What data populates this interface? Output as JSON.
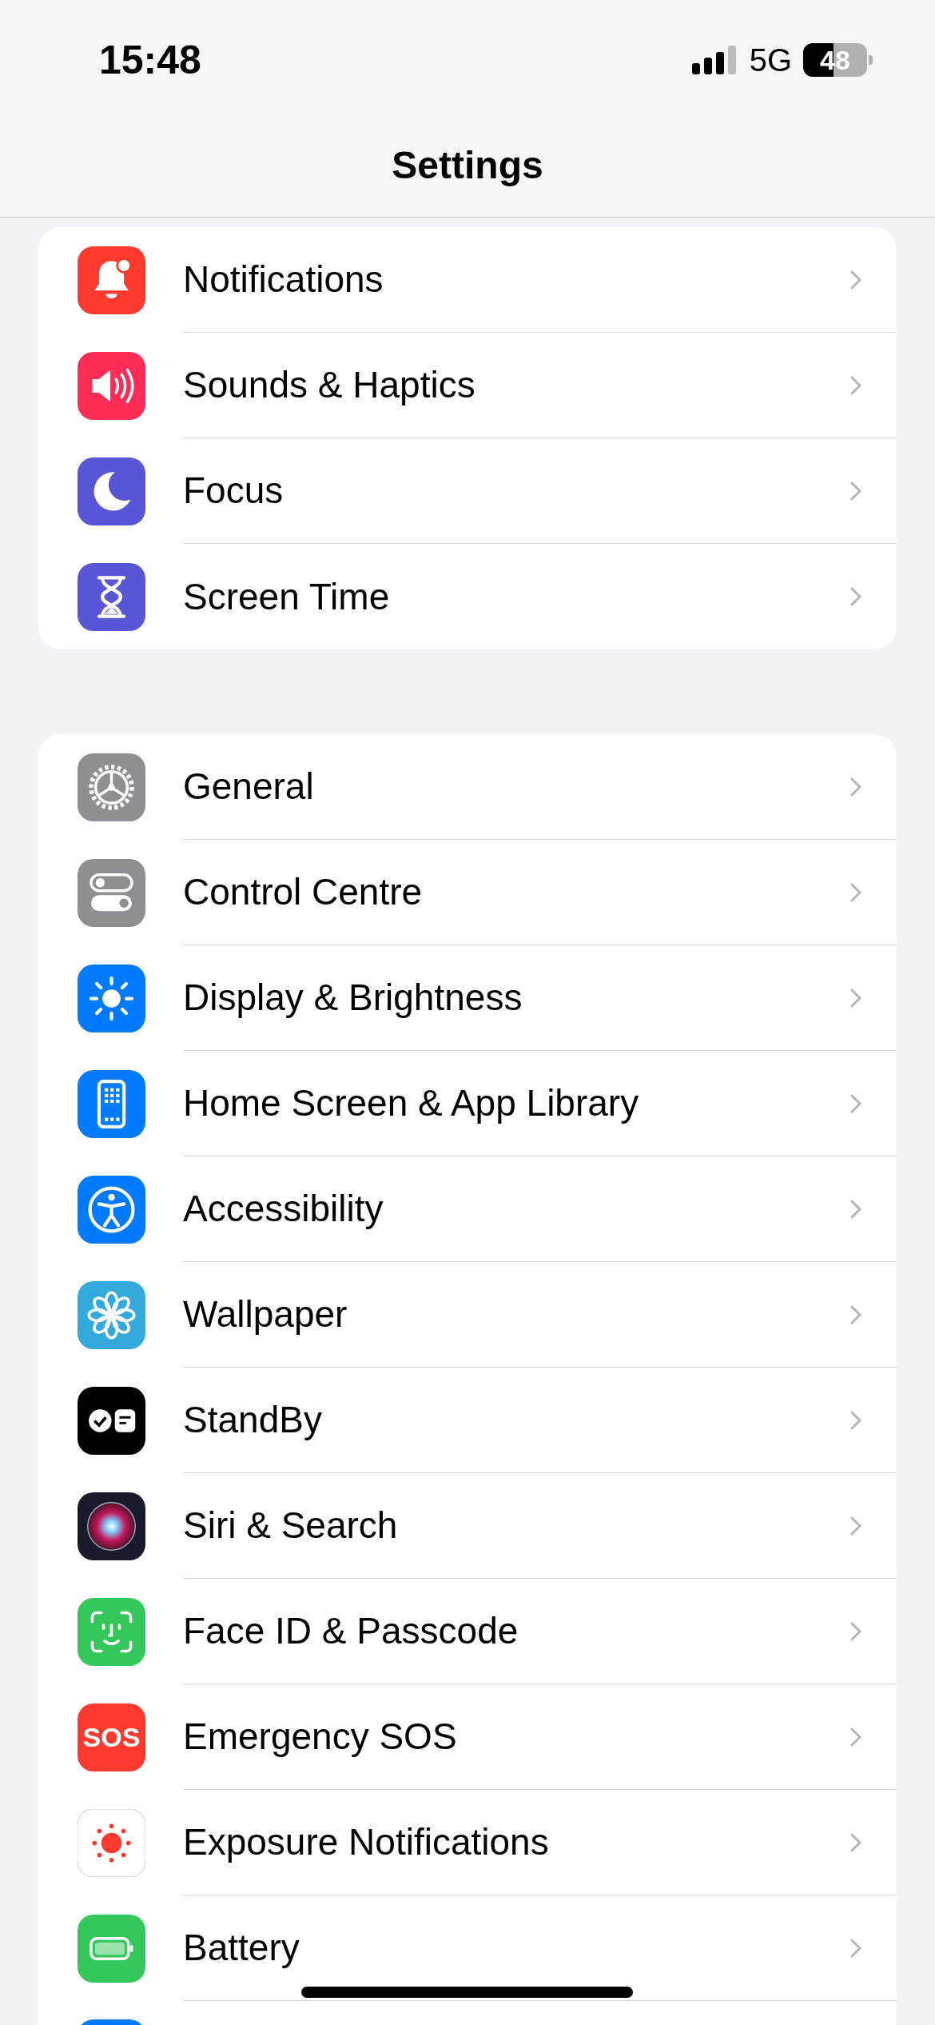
{
  "status_bar": {
    "time": "15:48",
    "network": "5G",
    "battery": "48"
  },
  "title": "Settings",
  "groups": [
    {
      "items": [
        {
          "kind": "bell",
          "label": "Notifications"
        },
        {
          "kind": "speaker",
          "label": "Sounds & Haptics"
        },
        {
          "kind": "moon",
          "label": "Focus"
        },
        {
          "kind": "hourglass",
          "label": "Screen Time"
        }
      ]
    },
    {
      "items": [
        {
          "kind": "gear",
          "label": "General"
        },
        {
          "kind": "toggles",
          "label": "Control Centre"
        },
        {
          "kind": "sun",
          "label": "Display & Brightness"
        },
        {
          "kind": "phone",
          "label": "Home Screen & App Library"
        },
        {
          "kind": "accessibility",
          "label": "Accessibility"
        },
        {
          "kind": "flower",
          "label": "Wallpaper"
        },
        {
          "kind": "standby",
          "label": "StandBy"
        },
        {
          "kind": "siri",
          "label": "Siri & Search"
        },
        {
          "kind": "face",
          "label": "Face ID & Passcode"
        },
        {
          "kind": "sos",
          "label": "Emergency SOS",
          "icon_text": "SOS"
        },
        {
          "kind": "exposure",
          "label": "Exposure Notifications"
        },
        {
          "kind": "battery",
          "label": "Battery"
        },
        {
          "kind": "partial"
        }
      ]
    }
  ]
}
